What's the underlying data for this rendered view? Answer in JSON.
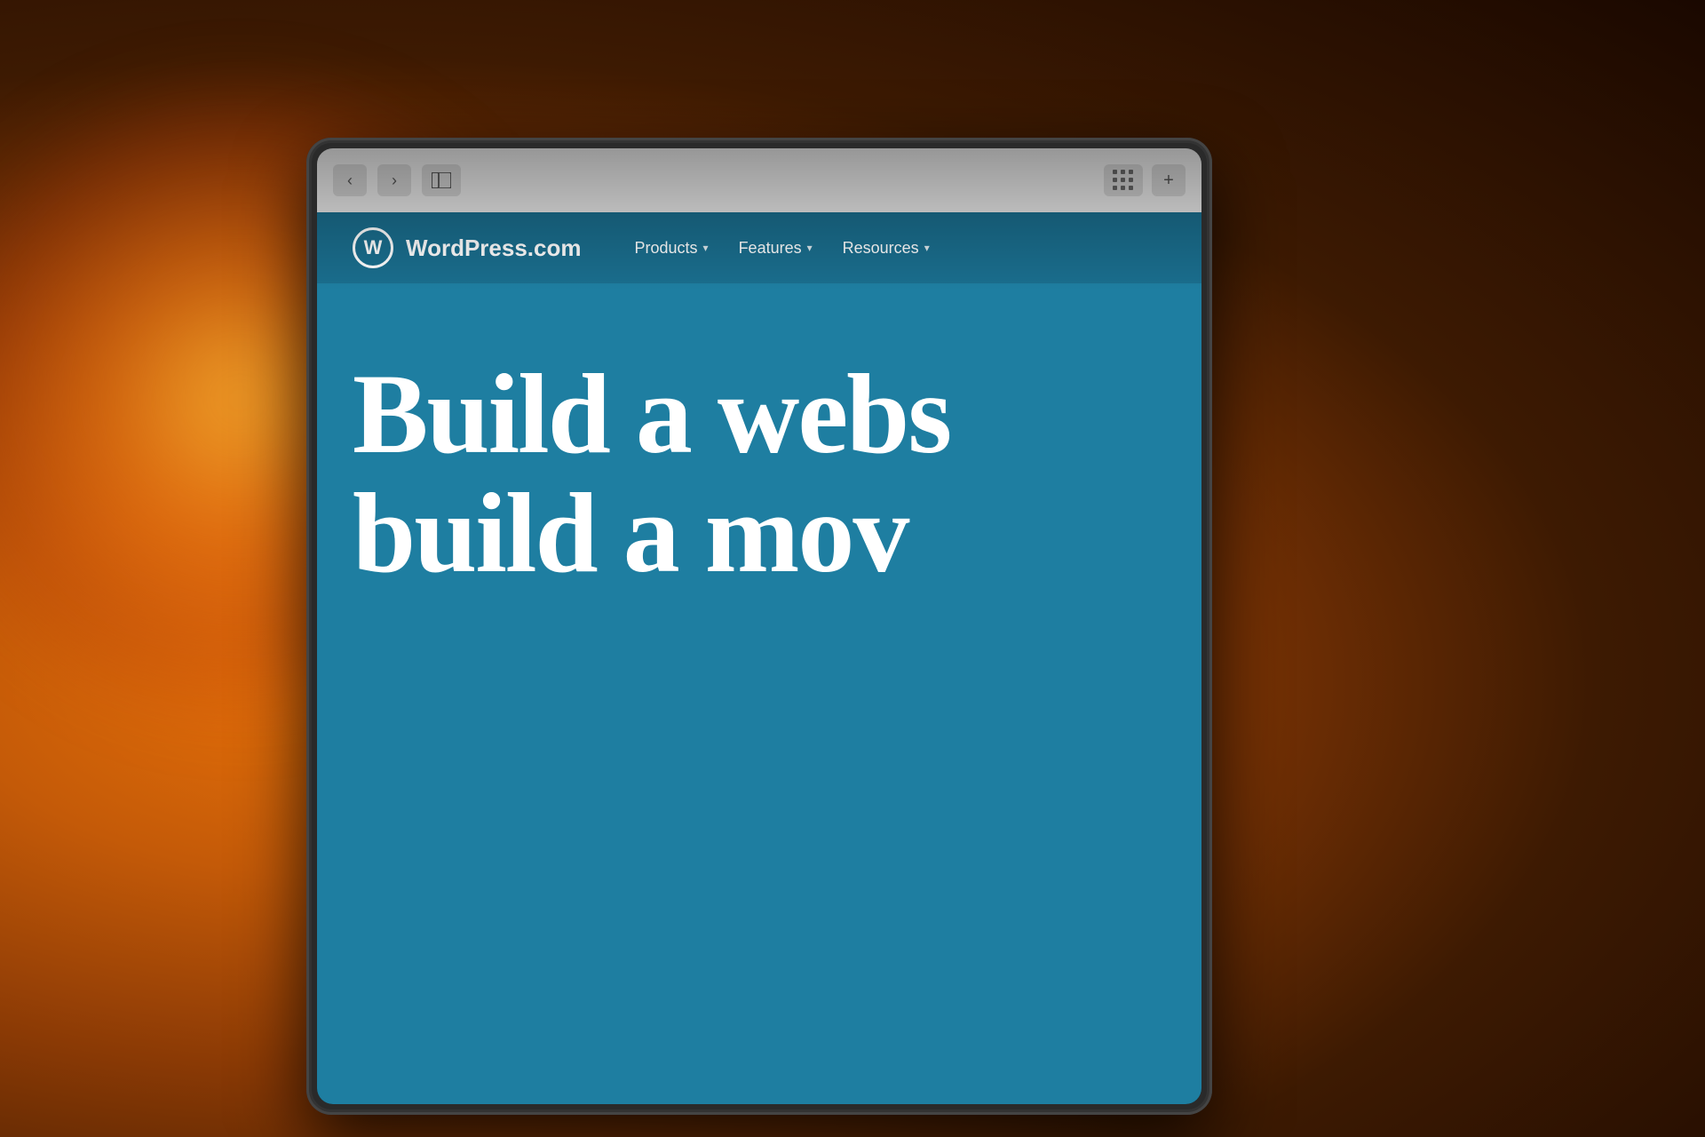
{
  "background": {
    "description": "warm bokeh background, orange/amber tones"
  },
  "browser": {
    "back_button": "‹",
    "forward_button": "›",
    "sidebar_button": "⊟",
    "plus_button": "+"
  },
  "website": {
    "logo_icon": "W",
    "logo_text": "WordPress.com",
    "nav_items": [
      {
        "label": "Products",
        "has_dropdown": true
      },
      {
        "label": "Features",
        "has_dropdown": true
      },
      {
        "label": "Resources",
        "has_dropdown": true
      }
    ],
    "hero_line1": "Build a webs",
    "hero_line2": "build a mov",
    "hero_bg_color": "#2077a0"
  }
}
